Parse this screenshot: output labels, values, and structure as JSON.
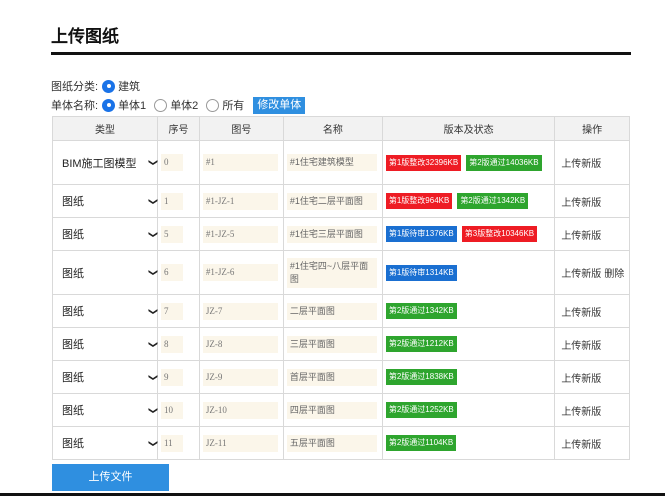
{
  "title": "上传图纸",
  "filters": {
    "category_label": "图纸分类:",
    "category_options": [
      {
        "label": "建筑",
        "checked": true
      }
    ],
    "unit_label": "单体名称:",
    "unit_options": [
      {
        "label": "单体1",
        "checked": true
      },
      {
        "label": "单体2",
        "checked": false
      },
      {
        "label": "所有",
        "checked": false
      }
    ],
    "edit_button": "修改单体"
  },
  "table": {
    "headers": [
      "类型",
      "序号",
      "图号",
      "名称",
      "版本及状态",
      "操作"
    ],
    "rows": [
      {
        "type": "BIM施工图模型",
        "num": "0",
        "code": "#1",
        "name": "#1住宅建筑模型",
        "versions": [
          {
            "text": "第1版整改32396KB",
            "color": "red"
          },
          {
            "text": "第2版通过14036KB",
            "color": "green"
          }
        ],
        "ops": [
          "上传新版"
        ]
      },
      {
        "type": "图纸",
        "num": "1",
        "code": "#1-JZ-1",
        "name": "#1住宅二层平面图",
        "versions": [
          {
            "text": "第1版整改964KB",
            "color": "red"
          },
          {
            "text": "第2版通过1342KB",
            "color": "green"
          }
        ],
        "ops": [
          "上传新版"
        ]
      },
      {
        "type": "图纸",
        "num": "5",
        "code": "#1-JZ-5",
        "name": "#1住宅三层平面图",
        "versions": [
          {
            "text": "第1版待审1376KB",
            "color": "blue"
          },
          {
            "text": "第3版整改10346KB",
            "color": "red"
          }
        ],
        "ops": [
          "上传新版"
        ]
      },
      {
        "type": "图纸",
        "num": "6",
        "code": "#1-JZ-6",
        "name": "#1住宅四~八层平面图",
        "versions": [
          {
            "text": "第1版待审1314KB",
            "color": "blue"
          }
        ],
        "ops": [
          "上传新版",
          "删除"
        ]
      },
      {
        "type": "图纸",
        "num": "7",
        "code": "JZ-7",
        "name": "二层平面图",
        "versions": [
          {
            "text": "第2版通过1342KB",
            "color": "green"
          }
        ],
        "ops": [
          "上传新版"
        ]
      },
      {
        "type": "图纸",
        "num": "8",
        "code": "JZ-8",
        "name": "三层平面图",
        "versions": [
          {
            "text": "第2版通过1212KB",
            "color": "green"
          }
        ],
        "ops": [
          "上传新版"
        ]
      },
      {
        "type": "图纸",
        "num": "9",
        "code": "JZ-9",
        "name": "首层平面图",
        "versions": [
          {
            "text": "第2版通过1838KB",
            "color": "green"
          }
        ],
        "ops": [
          "上传新版"
        ]
      },
      {
        "type": "图纸",
        "num": "10",
        "code": "JZ-10",
        "name": "四层平面图",
        "versions": [
          {
            "text": "第2版通过1252KB",
            "color": "green"
          }
        ],
        "ops": [
          "上传新版"
        ]
      },
      {
        "type": "图纸",
        "num": "11",
        "code": "JZ-11",
        "name": "五层平面图",
        "versions": [
          {
            "text": "第2版通过1104KB",
            "color": "green"
          }
        ],
        "ops": [
          "上传新版"
        ]
      }
    ]
  },
  "upload_button": "上传文件",
  "colors": {
    "accent": "#2f8fe0",
    "red": "#ee1c24",
    "green": "#2ea52e",
    "blue": "#1a6fd1"
  }
}
